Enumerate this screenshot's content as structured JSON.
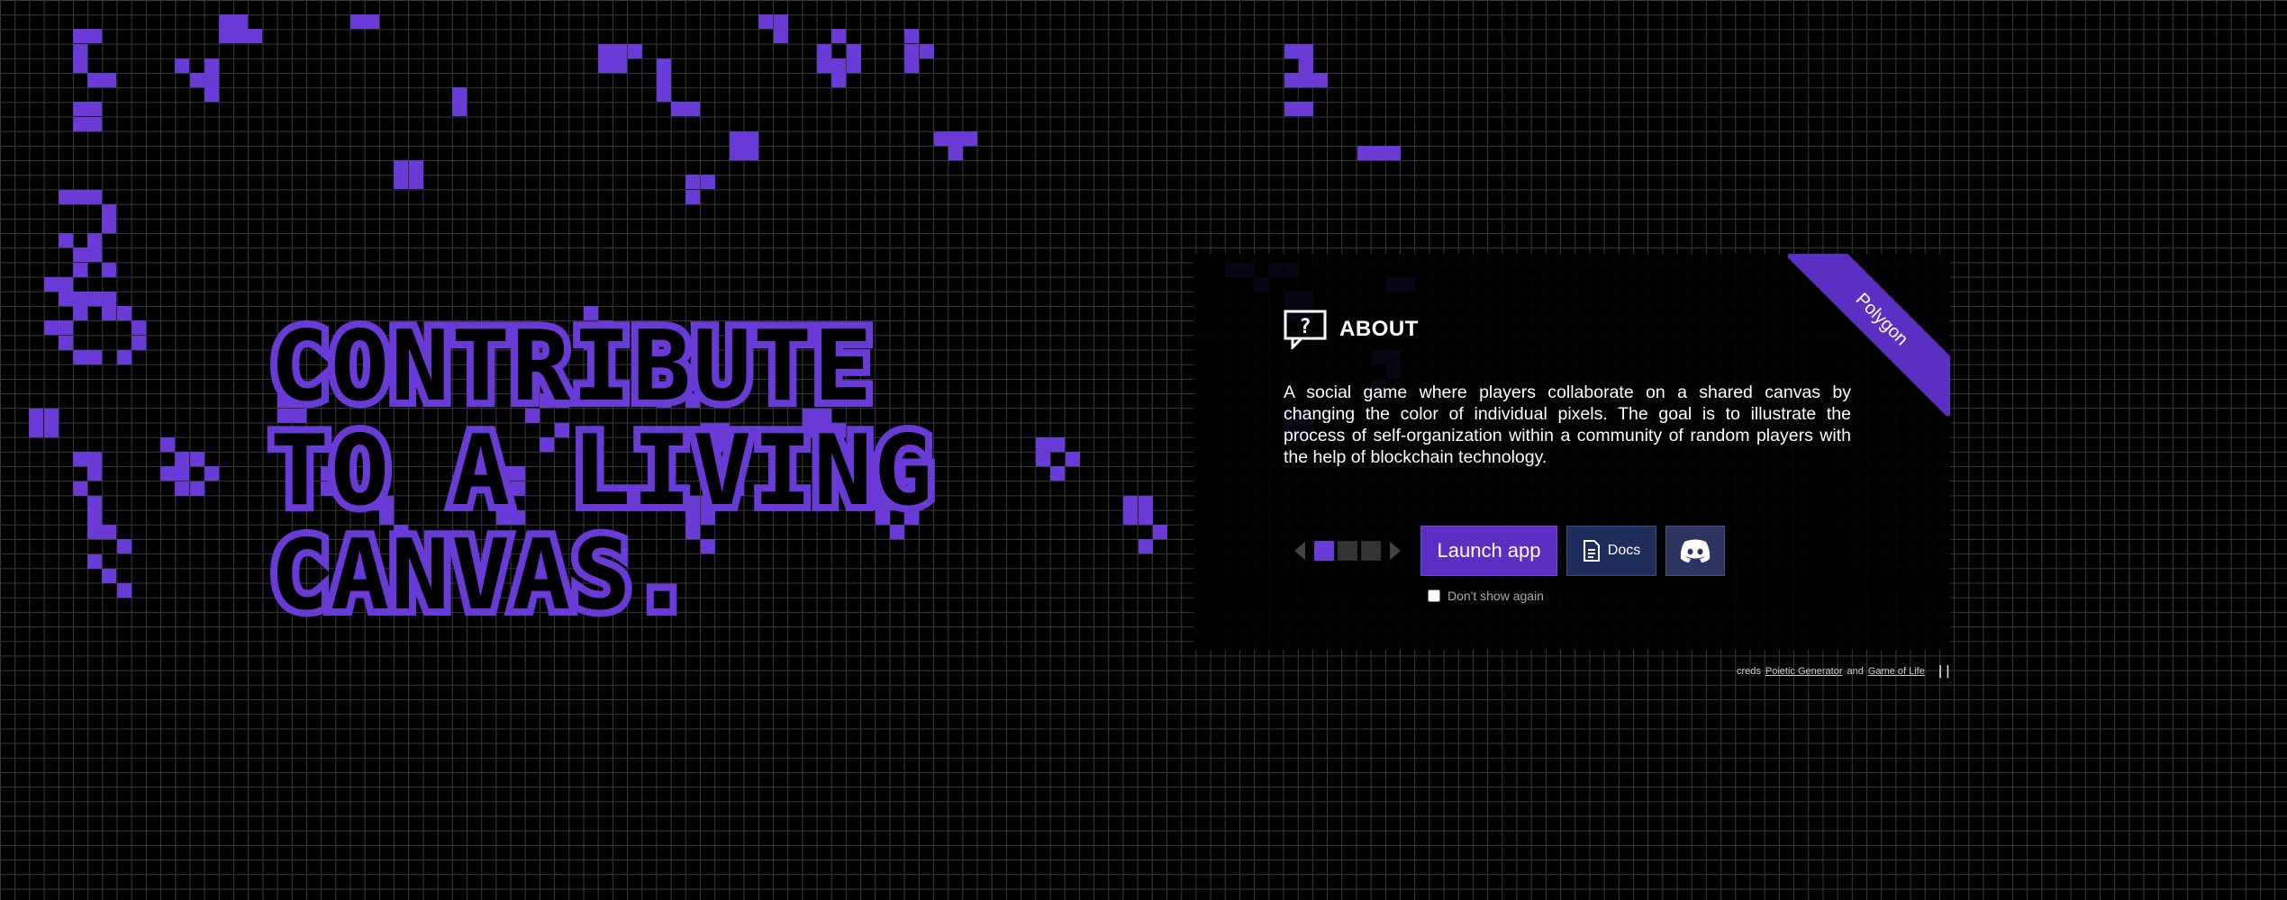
{
  "hero": {
    "line1": "CONTRIBUTE",
    "line2": "TO A LIVING",
    "line3": "CANVAS."
  },
  "about": {
    "ribbon": "Polygon",
    "title": "ABOUT",
    "icon": "speech-bubble-question-icon",
    "description": "A social game where players collaborate on a shared canvas by changing the color of individual pixels. The goal is to illustrate the process of self-organization within a community of random players with the help of blockchain technology.",
    "launch_label": "Launch app",
    "docs_label": "Docs",
    "discord_icon": "discord-icon",
    "dont_show_label": "Don't show again"
  },
  "footer": {
    "creds_prefix": "creds",
    "link1": "Poietic Generator",
    "and": "and",
    "link2": "Game of Life",
    "pause_label": "||"
  },
  "colors": {
    "accent": "#6a3ad6",
    "grid_line": "#3a3a3a",
    "docs_bg": "#1f2d5c"
  }
}
